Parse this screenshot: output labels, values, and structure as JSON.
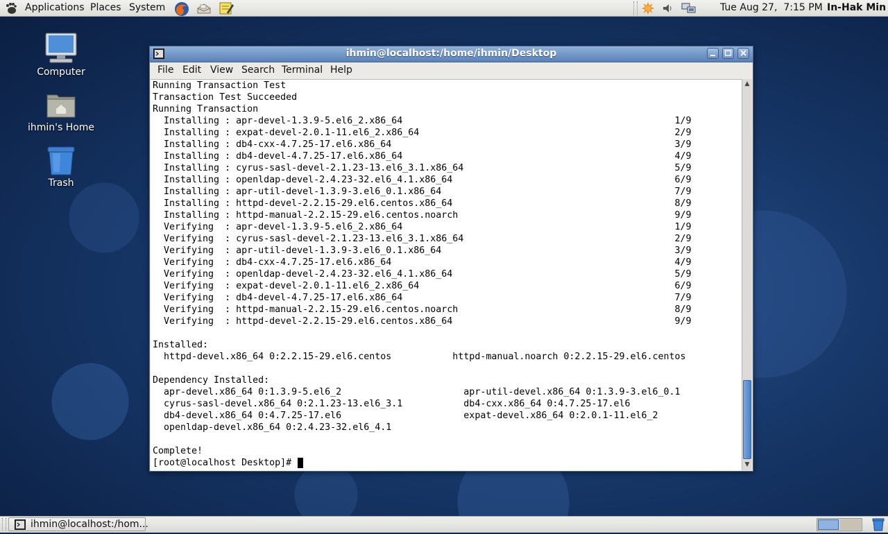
{
  "top_panel": {
    "menu": [
      "Applications",
      "Places",
      "System"
    ],
    "clock": "Tue Aug 27,  7:15 PM",
    "user": "In-Hak Min"
  },
  "desktop_icons": [
    {
      "label": "Computer",
      "icon": "computer-icon"
    },
    {
      "label": "ihmin's Home",
      "icon": "home-folder-icon"
    },
    {
      "label": "Trash",
      "icon": "trash-icon"
    }
  ],
  "window": {
    "title": "ihmin@localhost:/home/ihmin/Desktop",
    "menu": [
      "File",
      "Edit",
      "View",
      "Search",
      "Terminal",
      "Help"
    ]
  },
  "terminal_lines": [
    "Running Transaction Test",
    "Transaction Test Succeeded",
    "Running Transaction",
    "  Installing : apr-devel-1.3.9-5.el6_2.x86_64                                                 1/9",
    "  Installing : expat-devel-2.0.1-11.el6_2.x86_64                                              2/9",
    "  Installing : db4-cxx-4.7.25-17.el6.x86_64                                                   3/9",
    "  Installing : db4-devel-4.7.25-17.el6.x86_64                                                 4/9",
    "  Installing : cyrus-sasl-devel-2.1.23-13.el6_3.1.x86_64                                      5/9",
    "  Installing : openldap-devel-2.4.23-32.el6_4.1.x86_64                                        6/9",
    "  Installing : apr-util-devel-1.3.9-3.el6_0.1.x86_64                                          7/9",
    "  Installing : httpd-devel-2.2.15-29.el6.centos.x86_64                                        8/9",
    "  Installing : httpd-manual-2.2.15-29.el6.centos.noarch                                       9/9",
    "  Verifying  : apr-devel-1.3.9-5.el6_2.x86_64                                                 1/9",
    "  Verifying  : cyrus-sasl-devel-2.1.23-13.el6_3.1.x86_64                                      2/9",
    "  Verifying  : apr-util-devel-1.3.9-3.el6_0.1.x86_64                                          3/9",
    "  Verifying  : db4-cxx-4.7.25-17.el6.x86_64                                                   4/9",
    "  Verifying  : openldap-devel-2.4.23-32.el6_4.1.x86_64                                        5/9",
    "  Verifying  : expat-devel-2.0.1-11.el6_2.x86_64                                              6/9",
    "  Verifying  : db4-devel-4.7.25-17.el6.x86_64                                                 7/9",
    "  Verifying  : httpd-manual-2.2.15-29.el6.centos.noarch                                       8/9",
    "  Verifying  : httpd-devel-2.2.15-29.el6.centos.x86_64                                        9/9",
    "",
    "Installed:",
    "  httpd-devel.x86_64 0:2.2.15-29.el6.centos           httpd-manual.noarch 0:2.2.15-29.el6.centos",
    "",
    "Dependency Installed:",
    "  apr-devel.x86_64 0:1.3.9-5.el6_2                      apr-util-devel.x86_64 0:1.3.9-3.el6_0.1",
    "  cyrus-sasl-devel.x86_64 0:2.1.23-13.el6_3.1           db4-cxx.x86_64 0:4.7.25-17.el6",
    "  db4-devel.x86_64 0:4.7.25-17.el6                      expat-devel.x86_64 0:2.0.1-11.el6_2",
    "  openldap-devel.x86_64 0:2.4.23-32.el6_4.1",
    "",
    "Complete!",
    "[root@localhost Desktop]# "
  ],
  "taskbar": {
    "task_label": "ihmin@localhost:/hom..."
  },
  "colors": {
    "title_bar": "#5a82b8",
    "desktop": "#17386a",
    "terminal_bg": "#ffffff"
  }
}
